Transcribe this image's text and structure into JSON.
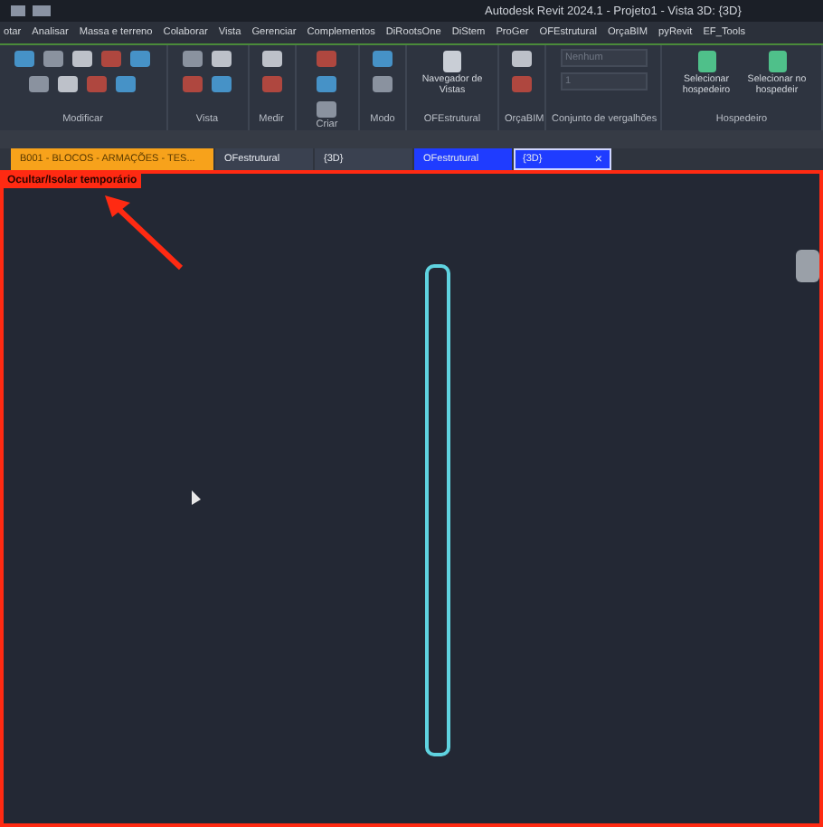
{
  "window": {
    "title": "Autodesk Revit 2024.1 - Projeto1 - Vista 3D: {3D}"
  },
  "menu_tabs": [
    "otar",
    "Analisar",
    "Massa e terreno",
    "Colaborar",
    "Vista",
    "Gerenciar",
    "Complementos",
    "DiRootsOne",
    "DiStem",
    "ProGer",
    "OFEstrutural",
    "OrçaBIM",
    "pyRevit",
    "EF_Tools"
  ],
  "ribbon_panels": [
    {
      "kind": "tools",
      "label": "Modificar"
    },
    {
      "kind": "tools",
      "label": "Vista"
    },
    {
      "kind": "tools",
      "label": "Medir"
    },
    {
      "kind": "tools",
      "label": "Criar"
    },
    {
      "kind": "tools",
      "label": "Modo"
    },
    {
      "kind": "buttons",
      "label": "OFEstrutural",
      "buttons": [
        "Navegador de Vistas"
      ]
    },
    {
      "kind": "tools",
      "label": "OrçaBIM"
    },
    {
      "kind": "fields",
      "label": "Conjunto de vergalhões",
      "fields": [
        "Nenhum",
        "1"
      ]
    },
    {
      "kind": "buttons",
      "label": "Hospedeiro",
      "buttons": [
        "Selecionar hospedeiro",
        "Selecionar no hospedeir"
      ]
    }
  ],
  "view_tabs": [
    {
      "label": "B001 - BLOCOS - ARMAÇÕES - TES...",
      "color": "#f7a21b",
      "selected": false
    },
    {
      "label": "OFestrutural",
      "color": "#3a4150",
      "selected": false
    },
    {
      "label": "{3D}",
      "color": "#3a4150",
      "selected": false
    },
    {
      "label": "OFestrutural",
      "color": "#1f3cff",
      "selected": false
    },
    {
      "label": "{3D}",
      "color": "#1f3cff",
      "selected": true,
      "close": "×"
    }
  ],
  "viewport": {
    "mode_label": "Ocultar/Isolar temporário",
    "isolate_active": true
  }
}
